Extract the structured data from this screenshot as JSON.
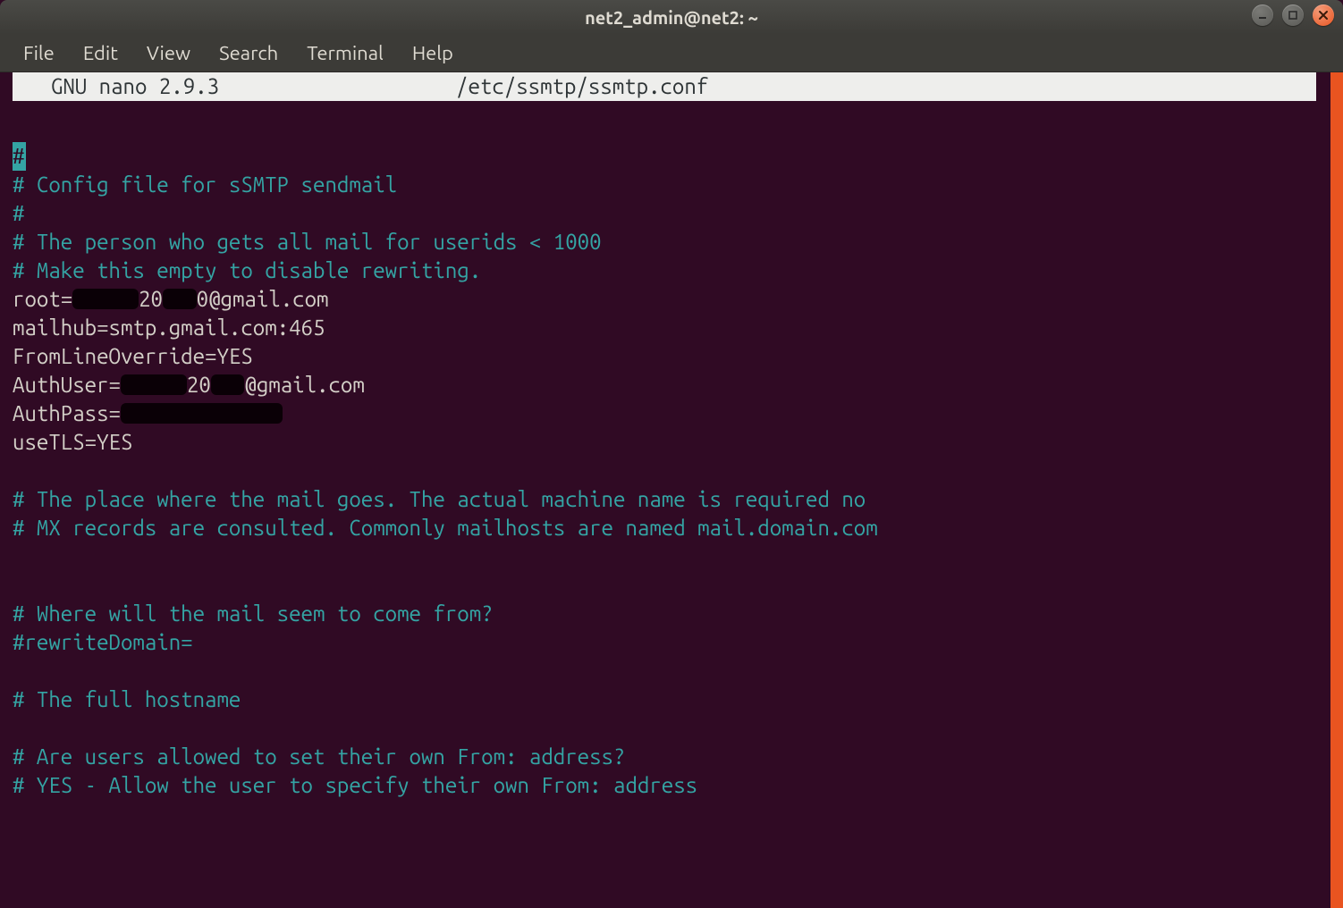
{
  "window": {
    "title": "net2_admin@net2: ~"
  },
  "menubar": {
    "items": [
      "File",
      "Edit",
      "View",
      "Search",
      "Terminal",
      "Help"
    ]
  },
  "nano": {
    "app_label": "  GNU nano 2.9.3",
    "file_path": "/etc/ssmtp/ssmtp.conf"
  },
  "file": {
    "l1_hash": "#",
    "l2": "# Config file for sSMTP sendmail",
    "l3": "#",
    "l4": "# The person who gets all mail for userids < 1000",
    "l5": "# Make this empty to disable rewriting.",
    "root_prefix": "root=",
    "root_mid": "20",
    "root_suffix": "0@gmail.com",
    "mailhub": "mailhub=smtp.gmail.com:465",
    "fromline": "FromLineOverride=YES",
    "authuser_prefix": "AuthUser=",
    "authuser_mid": "20",
    "authuser_suffix": "@gmail.com",
    "authpass_prefix": "AuthPass=",
    "usetls": "useTLS=YES",
    "l_place1": "# The place where the mail goes. The actual machine name is required no",
    "l_place2": "# MX records are consulted. Commonly mailhosts are named mail.domain.com",
    "l_where": "# Where will the mail seem to come from?",
    "l_rewrite": "#rewriteDomain=",
    "l_fullhost": "# The full hostname",
    "l_allow1": "# Are users allowed to set their own From: address?",
    "l_allow2": "# YES - Allow the user to specify their own From: address"
  }
}
